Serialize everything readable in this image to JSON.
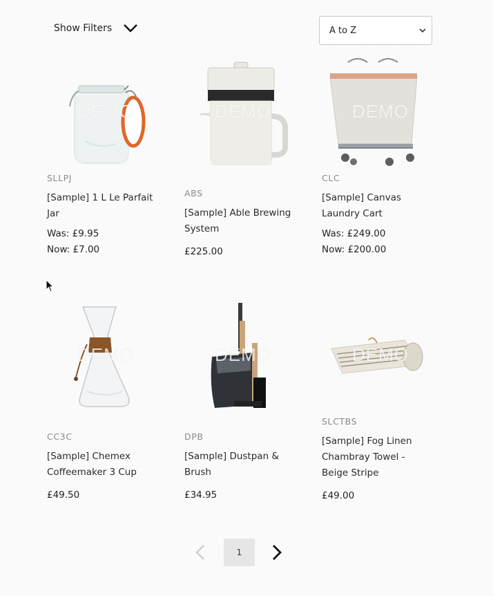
{
  "toolbar": {
    "filters_label": "Show Filters",
    "sort_value": "A to Z",
    "sort_options": [
      "A to Z"
    ]
  },
  "products": [
    {
      "sku": "SLLPJ",
      "title_l1": "[Sample] 1 L Le Parfait",
      "title_l2": "Jar",
      "price_l1": "Was: £9.95",
      "price_l2": "Now: £7.00",
      "watermark": "DEMO",
      "image": "glass-jar-image"
    },
    {
      "sku": "ABS",
      "title_l1": "[Sample] Able Brewing",
      "title_l2": "System",
      "price_l1": "£225.00",
      "price_l2": "",
      "watermark": "DEMO",
      "image": "brewing-system-image"
    },
    {
      "sku": "CLC",
      "title_l1": "[Sample] Canvas",
      "title_l2": "Laundry Cart",
      "price_l1": "Was: £249.00",
      "price_l2": "Now: £200.00",
      "watermark": "DEMO",
      "image": "laundry-cart-image"
    },
    {
      "sku": "CC3C",
      "title_l1": "[Sample] Chemex",
      "title_l2": "Coffeemaker 3 Cup",
      "price_l1": "£49.50",
      "price_l2": "",
      "watermark": "DEMO",
      "image": "chemex-image"
    },
    {
      "sku": "DPB",
      "title_l1": "[Sample] Dustpan &",
      "title_l2": "Brush",
      "price_l1": "£34.95",
      "price_l2": "",
      "watermark": "DEMO",
      "image": "dustpan-image"
    },
    {
      "sku": "SLCTBS",
      "title_l1": "[Sample] Fog Linen",
      "title_l2": "Chambray Towel -",
      "title_l3": "Beige Stripe",
      "price_l1": "£49.00",
      "price_l2": "",
      "watermark": "DEMO",
      "image": "towel-image"
    }
  ],
  "pagination": {
    "current_page": "1",
    "prev_icon": "chevron-left-icon",
    "next_icon": "chevron-right-icon"
  },
  "colors": {
    "jar_seal": "#e0662a",
    "brew_band": "#2a2a2a",
    "leather_tie": "#8a5528",
    "disabled_chevron": "#cfcfcf"
  }
}
